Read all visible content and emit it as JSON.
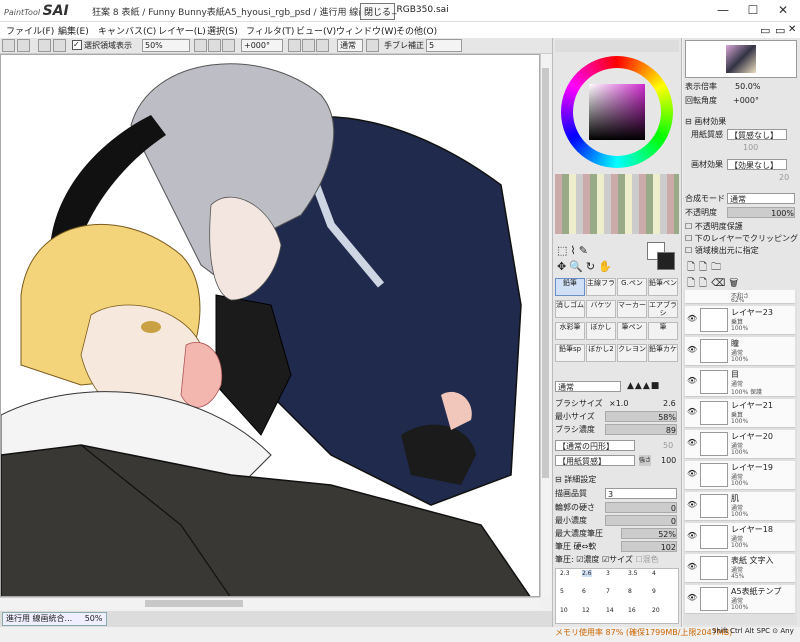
{
  "app": {
    "logo_small": "PaintTool",
    "logo_big": "SAI",
    "title": "狂案 8 表紙 / Funny Bunny表紙A5_hyousi_rgb_psd / 進行用  線画統合",
    "close_tooltip": "閉じる",
    "title_suffix": "_RGB350.sai"
  },
  "menu": [
    "ファイル(F)",
    "編集(E)",
    "キャンバス(C)",
    "レイヤー(L)",
    "選択(S)",
    "フィルタ(T)",
    "ビュー(V)",
    "ウィンドウ(W)",
    "その他(O)"
  ],
  "toolbar": {
    "show_selection": "選択領域表示",
    "zoom": "50%",
    "rotation": "+000°",
    "blend": "通常",
    "stabilizer_label": "手ブレ補正",
    "stabilizer": "5"
  },
  "status": {
    "doc": "進行用  線画統合...",
    "zoom": "50%",
    "memory": "メモリ使用率 87% (確保1799MB/上限2047MB)",
    "keys": "Shift Ctrl Alt SPC ⊙ Any"
  },
  "navigator": {
    "zoom_label": "表示倍率",
    "zoom": "50.0%",
    "rot_label": "回転角度",
    "rot": "+000°"
  },
  "paper": {
    "section": "画材効果",
    "texture_label": "用紙質感",
    "texture": "【質感なし】",
    "texture_val": "100",
    "effect_label": "画材効果",
    "effect": "【効果なし】",
    "effect_val": "20"
  },
  "layerprops": {
    "blend_label": "合成モード",
    "blend": "通常",
    "opacity_label": "不透明度",
    "opacity": "100%",
    "opt1": "不透明度保護",
    "opt2": "下のレイヤーでクリッピング",
    "opt3": "領域検出元に指定"
  },
  "tools": [
    "鉛筆",
    "主線フラ",
    "G.ペン",
    "鉛筆ペン",
    "消しゴム",
    "バケツ",
    "マーカー",
    "エアブラシ",
    "水彩筆",
    "ぼかし",
    "筆ペン",
    "筆",
    "鉛筆sp",
    "ぼかし2",
    "クレヨン",
    "鉛筆カケ"
  ],
  "brush": {
    "blend": "通常",
    "size_label": "ブラシサイズ",
    "size_mult": "×1.0",
    "size": "2.6",
    "min_label": "最小サイズ",
    "min": "58%",
    "density_label": "ブラシ濃度",
    "density": "89",
    "shape": "【通常の円形】",
    "shape_val": "50",
    "texture": "【用紙質感】",
    "tex_label": "強さ",
    "tex_val": "100",
    "detail": "詳細設定",
    "quality_label": "描画品質",
    "quality": "3",
    "hardness_label": "輪郭の硬さ",
    "hardness": "0",
    "mindens_label": "最小濃度",
    "mindens": "0",
    "maxdens_label": "最大濃度筆圧",
    "maxdens": "52%",
    "pressure_label": "筆圧 硬⇔軟",
    "pressure": "102",
    "press_label": "筆圧:",
    "press_dens": "濃度",
    "press_size": "サイズ",
    "press_mix": "混色"
  },
  "sizes": [
    "2.3",
    "2.6",
    "3",
    "3.5",
    "4",
    "5",
    "6",
    "7",
    "8",
    "9",
    "10",
    "12",
    "14",
    "16",
    "20"
  ],
  "layers": [
    {
      "name": "",
      "mode": "不和さ",
      "op": "62%"
    },
    {
      "name": "レイヤー23",
      "mode": "乗算",
      "op": "100%"
    },
    {
      "name": "瞳",
      "mode": "通常",
      "op": "100%"
    },
    {
      "name": "目",
      "mode": "通常",
      "op": "100% 保護"
    },
    {
      "name": "レイヤー21",
      "mode": "乗算",
      "op": "100%"
    },
    {
      "name": "レイヤー20",
      "mode": "通常",
      "op": "100%"
    },
    {
      "name": "レイヤー19",
      "mode": "通常",
      "op": "100%"
    },
    {
      "name": "肌",
      "mode": "通常",
      "op": "100%"
    },
    {
      "name": "レイヤー18",
      "mode": "通常",
      "op": "100%"
    },
    {
      "name": "表紙 文字入",
      "mode": "通常",
      "op": "45%"
    },
    {
      "name": "A5表紙テンプ",
      "mode": "通常",
      "op": "100%"
    }
  ]
}
